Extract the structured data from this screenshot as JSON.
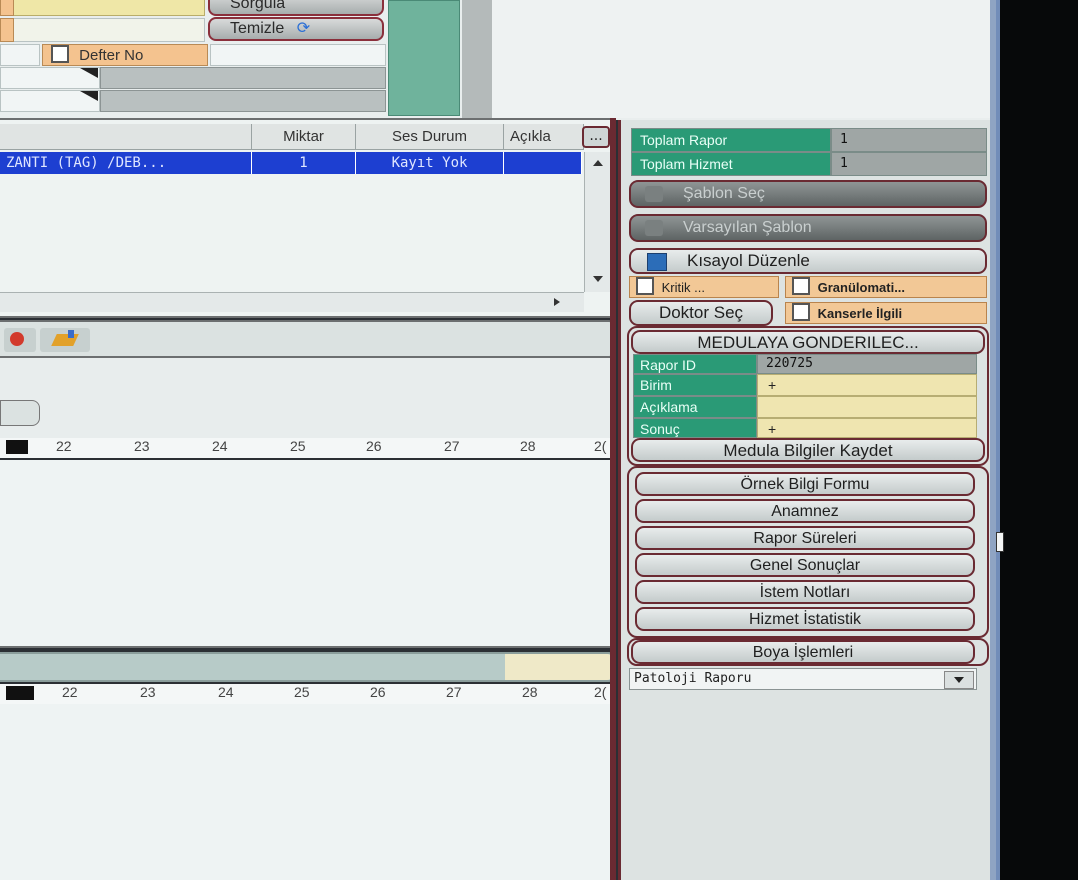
{
  "top": {
    "sorgula_label": "Sorgula",
    "temizle_label": "Temizle",
    "defter_no_label": "Defter No"
  },
  "grid": {
    "columns": [
      "Miktar",
      "Ses Durum",
      "Açıkla"
    ],
    "more_button": "...",
    "row": {
      "name": "ZANTI (TAG) /DEB...",
      "miktar": "1",
      "ses_durum": "Kayıt Yok"
    }
  },
  "ruler": {
    "ticks": [
      "22",
      "23",
      "24",
      "25",
      "26",
      "27",
      "28",
      "2("
    ]
  },
  "right": {
    "toplam_rapor_label": "Toplam Rapor",
    "toplam_rapor_value": "1",
    "toplam_hizmet_label": "Toplam Hizmet",
    "toplam_hizmet_value": "1",
    "sablon_sec": "Şablon Seç",
    "varsayilan_sablon": "Varsayılan Şablon",
    "kisayol_duzenle": "Kısayol Düzenle",
    "kritik": "Kritik ...",
    "granulomati": "Granülomati...",
    "doktor_sec": "Doktor Seç",
    "kanserle_ilgili": "Kanserle İlgili",
    "medula_button": "MEDULAYA GONDERILEC...",
    "rapor_id_label": "Rapor ID",
    "rapor_id_value": "220725",
    "birim_label": "Birim",
    "birim_value": "+",
    "aciklama_label": "Açıklama",
    "aciklama_value": "",
    "sonuc_label": "Sonuç",
    "sonuc_value": "+",
    "medula_kaydet": "Medula Bilgiler Kaydet",
    "buttons": [
      "Örnek Bilgi Formu",
      "Anamnez",
      "Rapor Süreleri",
      "Genel Sonuçlar",
      "İstem Notları",
      "Hizmet İstatistik"
    ],
    "boya_islemleri": "Boya İşlemleri",
    "report_type": "Patoloji Raporu"
  }
}
